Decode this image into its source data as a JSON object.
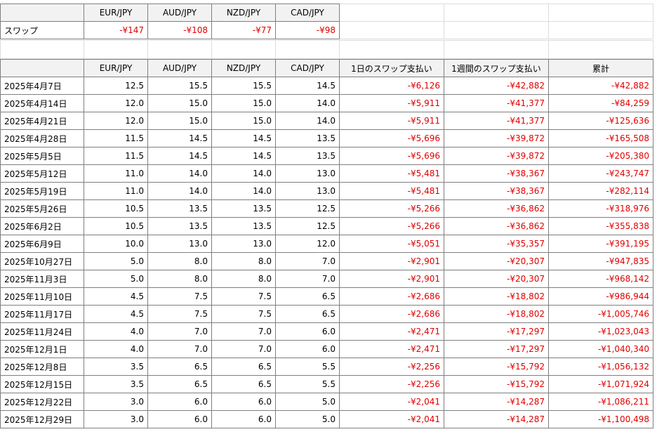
{
  "top_table": {
    "headers": [
      "",
      "EUR/JPY",
      "AUD/JPY",
      "NZD/JPY",
      "CAD/JPY"
    ],
    "row": {
      "label": "スワップ",
      "values": [
        "-¥147",
        "-¥108",
        "-¥77",
        "-¥98"
      ]
    }
  },
  "main_table": {
    "headers": [
      "",
      "EUR/JPY",
      "AUD/JPY",
      "NZD/JPY",
      "CAD/JPY",
      "1日のスワップ支払い",
      "1週間のスワップ支払い",
      "累計"
    ],
    "rows": [
      [
        "2025年4月7日",
        "12.5",
        "15.5",
        "15.5",
        "14.5",
        "-¥6,126",
        "-¥42,882",
        "-¥42,882"
      ],
      [
        "2025年4月14日",
        "12.0",
        "15.0",
        "15.0",
        "14.0",
        "-¥5,911",
        "-¥41,377",
        "-¥84,259"
      ],
      [
        "2025年4月21日",
        "12.0",
        "15.0",
        "15.0",
        "14.0",
        "-¥5,911",
        "-¥41,377",
        "-¥125,636"
      ],
      [
        "2025年4月28日",
        "11.5",
        "14.5",
        "14.5",
        "13.5",
        "-¥5,696",
        "-¥39,872",
        "-¥165,508"
      ],
      [
        "2025年5月5日",
        "11.5",
        "14.5",
        "14.5",
        "13.5",
        "-¥5,696",
        "-¥39,872",
        "-¥205,380"
      ],
      [
        "2025年5月12日",
        "11.0",
        "14.0",
        "14.0",
        "13.0",
        "-¥5,481",
        "-¥38,367",
        "-¥243,747"
      ],
      [
        "2025年5月19日",
        "11.0",
        "14.0",
        "14.0",
        "13.0",
        "-¥5,481",
        "-¥38,367",
        "-¥282,114"
      ],
      [
        "2025年5月26日",
        "10.5",
        "13.5",
        "13.5",
        "12.5",
        "-¥5,266",
        "-¥36,862",
        "-¥318,976"
      ],
      [
        "2025年6月2日",
        "10.5",
        "13.5",
        "13.5",
        "12.5",
        "-¥5,266",
        "-¥36,862",
        "-¥355,838"
      ],
      [
        "2025年6月9日",
        "10.0",
        "13.0",
        "13.0",
        "12.0",
        "-¥5,051",
        "-¥35,357",
        "-¥391,195"
      ],
      [
        "2025年10月27日",
        "5.0",
        "8.0",
        "8.0",
        "7.0",
        "-¥2,901",
        "-¥20,307",
        "-¥947,835"
      ],
      [
        "2025年11月3日",
        "5.0",
        "8.0",
        "8.0",
        "7.0",
        "-¥2,901",
        "-¥20,307",
        "-¥968,142"
      ],
      [
        "2025年11月10日",
        "4.5",
        "7.5",
        "7.5",
        "6.5",
        "-¥2,686",
        "-¥18,802",
        "-¥986,944"
      ],
      [
        "2025年11月17日",
        "4.5",
        "7.5",
        "7.5",
        "6.5",
        "-¥2,686",
        "-¥18,802",
        "-¥1,005,746"
      ],
      [
        "2025年11月24日",
        "4.0",
        "7.0",
        "7.0",
        "6.0",
        "-¥2,471",
        "-¥17,297",
        "-¥1,023,043"
      ],
      [
        "2025年12月1日",
        "4.0",
        "7.0",
        "7.0",
        "6.0",
        "-¥2,471",
        "-¥17,297",
        "-¥1,040,340"
      ],
      [
        "2025年12月8日",
        "3.5",
        "6.5",
        "6.5",
        "5.5",
        "-¥2,256",
        "-¥15,792",
        "-¥1,056,132"
      ],
      [
        "2025年12月15日",
        "3.5",
        "6.5",
        "6.5",
        "5.5",
        "-¥2,256",
        "-¥15,792",
        "-¥1,071,924"
      ],
      [
        "2025年12月22日",
        "3.0",
        "6.0",
        "6.0",
        "5.0",
        "-¥2,041",
        "-¥14,287",
        "-¥1,086,211"
      ],
      [
        "2025年12月29日",
        "3.0",
        "6.0",
        "6.0",
        "5.0",
        "-¥2,041",
        "-¥14,287",
        "-¥1,100,498"
      ]
    ]
  },
  "colors": {
    "negative": "#e00000",
    "header_bg": "#f2f2f2",
    "border": "#7f7f7f"
  }
}
